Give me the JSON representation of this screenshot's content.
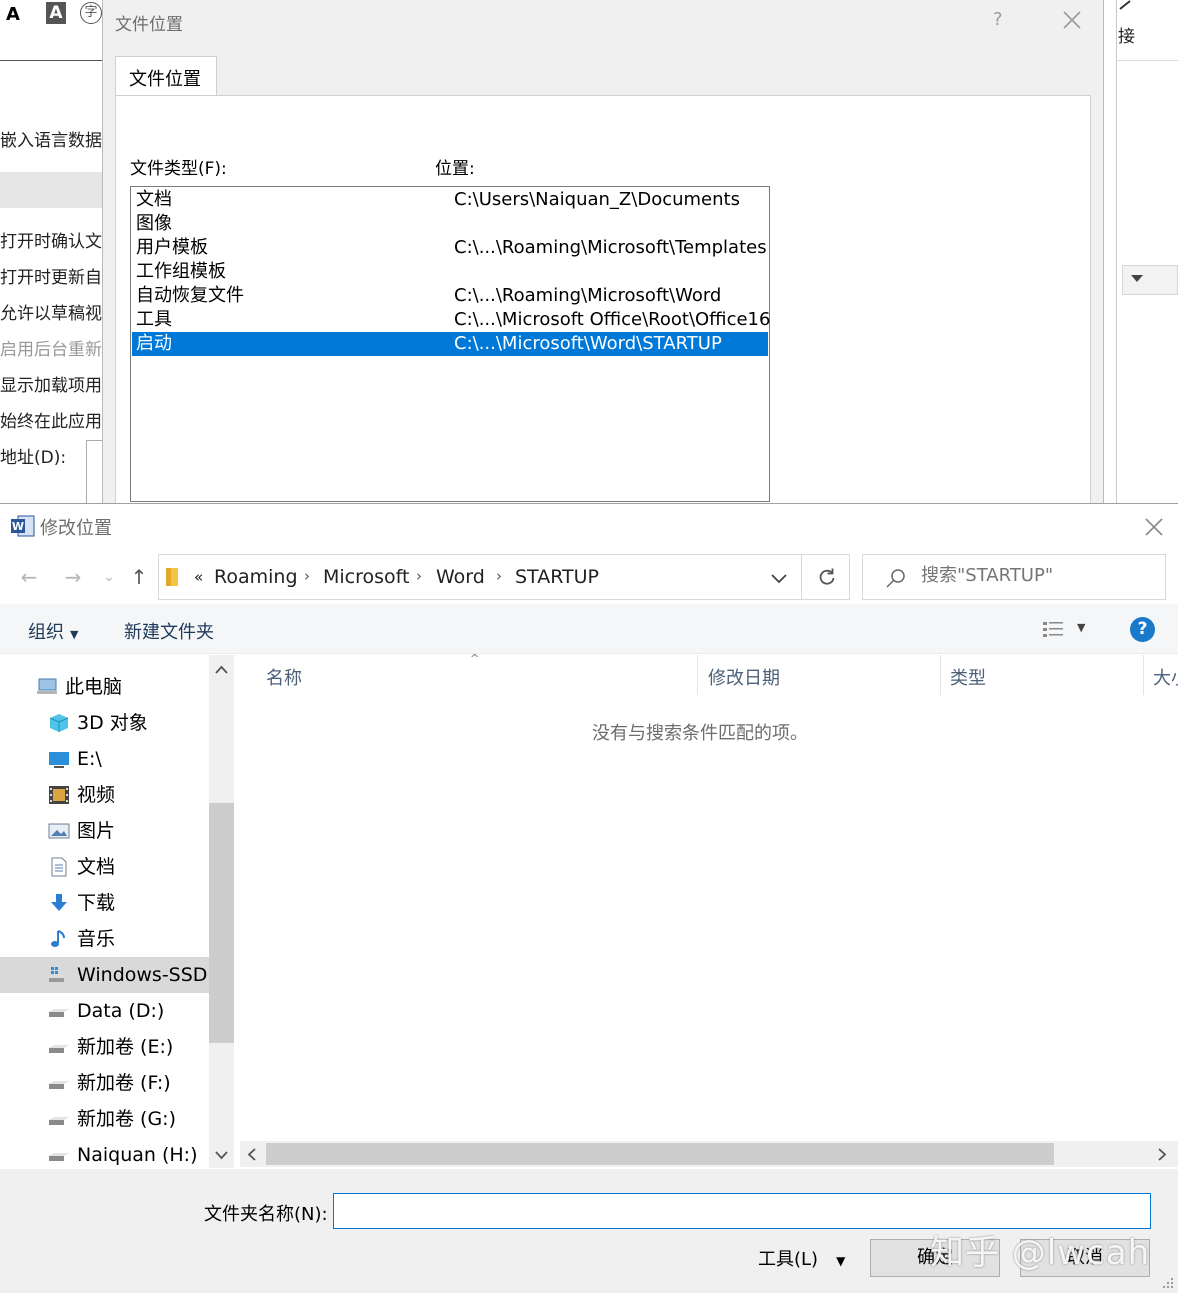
{
  "background_window": {
    "ribbon_glyphs": [
      "A",
      "A",
      "字"
    ],
    "options": [
      "嵌入语言数据",
      "打开时确认文",
      "打开时更新自",
      "允许以草稿视",
      "启用后台重新",
      "显示加载项用",
      "始终在此应用",
      "地址(D):"
    ],
    "right_fragment_text": "接"
  },
  "file_locations_dialog": {
    "title": "文件位置",
    "help": "?",
    "tab": "文件位置",
    "file_type_label": "文件类型(F):",
    "location_label": "位置:",
    "rows": [
      {
        "type": "文档",
        "path": "C:\\Users\\Naiquan_Z\\Documents"
      },
      {
        "type": "图像",
        "path": ""
      },
      {
        "type": "用户模板",
        "path": "C:\\...\\Roaming\\Microsoft\\Templates"
      },
      {
        "type": "工作组模板",
        "path": ""
      },
      {
        "type": "自动恢复文件",
        "path": "C:\\...\\Roaming\\Microsoft\\Word"
      },
      {
        "type": "工具",
        "path": "C:\\...\\Microsoft Office\\Root\\Office16"
      },
      {
        "type": "启动",
        "path": "C:\\...\\Microsoft\\Word\\STARTUP"
      }
    ],
    "selected_row": 6
  },
  "change_location_dialog": {
    "title": "修改位置",
    "breadcrumb_prefix": "«",
    "breadcrumb": [
      "Roaming",
      "Microsoft",
      "Word",
      "STARTUP"
    ],
    "search_placeholder": "搜索\"STARTUP\"",
    "toolbar": {
      "organize": "组织",
      "new_folder": "新建文件夹"
    },
    "nav_items": [
      {
        "label": "此电脑",
        "icon": "computer-icon"
      },
      {
        "label": "3D 对象",
        "icon": "cube-icon"
      },
      {
        "label": "E:\\",
        "icon": "monitor-icon"
      },
      {
        "label": "视频",
        "icon": "film-icon"
      },
      {
        "label": "图片",
        "icon": "picture-icon"
      },
      {
        "label": "文档",
        "icon": "document-icon"
      },
      {
        "label": "下载",
        "icon": "download-icon"
      },
      {
        "label": "音乐",
        "icon": "music-icon"
      },
      {
        "label": "Windows-SSD (",
        "icon": "windows-drive-icon"
      },
      {
        "label": "Data (D:)",
        "icon": "drive-icon"
      },
      {
        "label": "新加卷 (E:)",
        "icon": "drive-icon"
      },
      {
        "label": "新加卷 (F:)",
        "icon": "drive-icon"
      },
      {
        "label": "新加卷 (G:)",
        "icon": "drive-icon"
      },
      {
        "label": "Naiquan (H:)",
        "icon": "drive-icon"
      }
    ],
    "selected_nav": 8,
    "columns": [
      "名称",
      "修改日期",
      "类型",
      "大小"
    ],
    "empty_message": "没有与搜索条件匹配的项。",
    "folder_name_label": "文件夹名称(N):",
    "folder_name_value": "",
    "tools_label": "工具(L)",
    "ok_label": "确定",
    "cancel_label": "取消",
    "watermark": "知乎 @lwcah",
    "accent_color": "#0078d7"
  }
}
